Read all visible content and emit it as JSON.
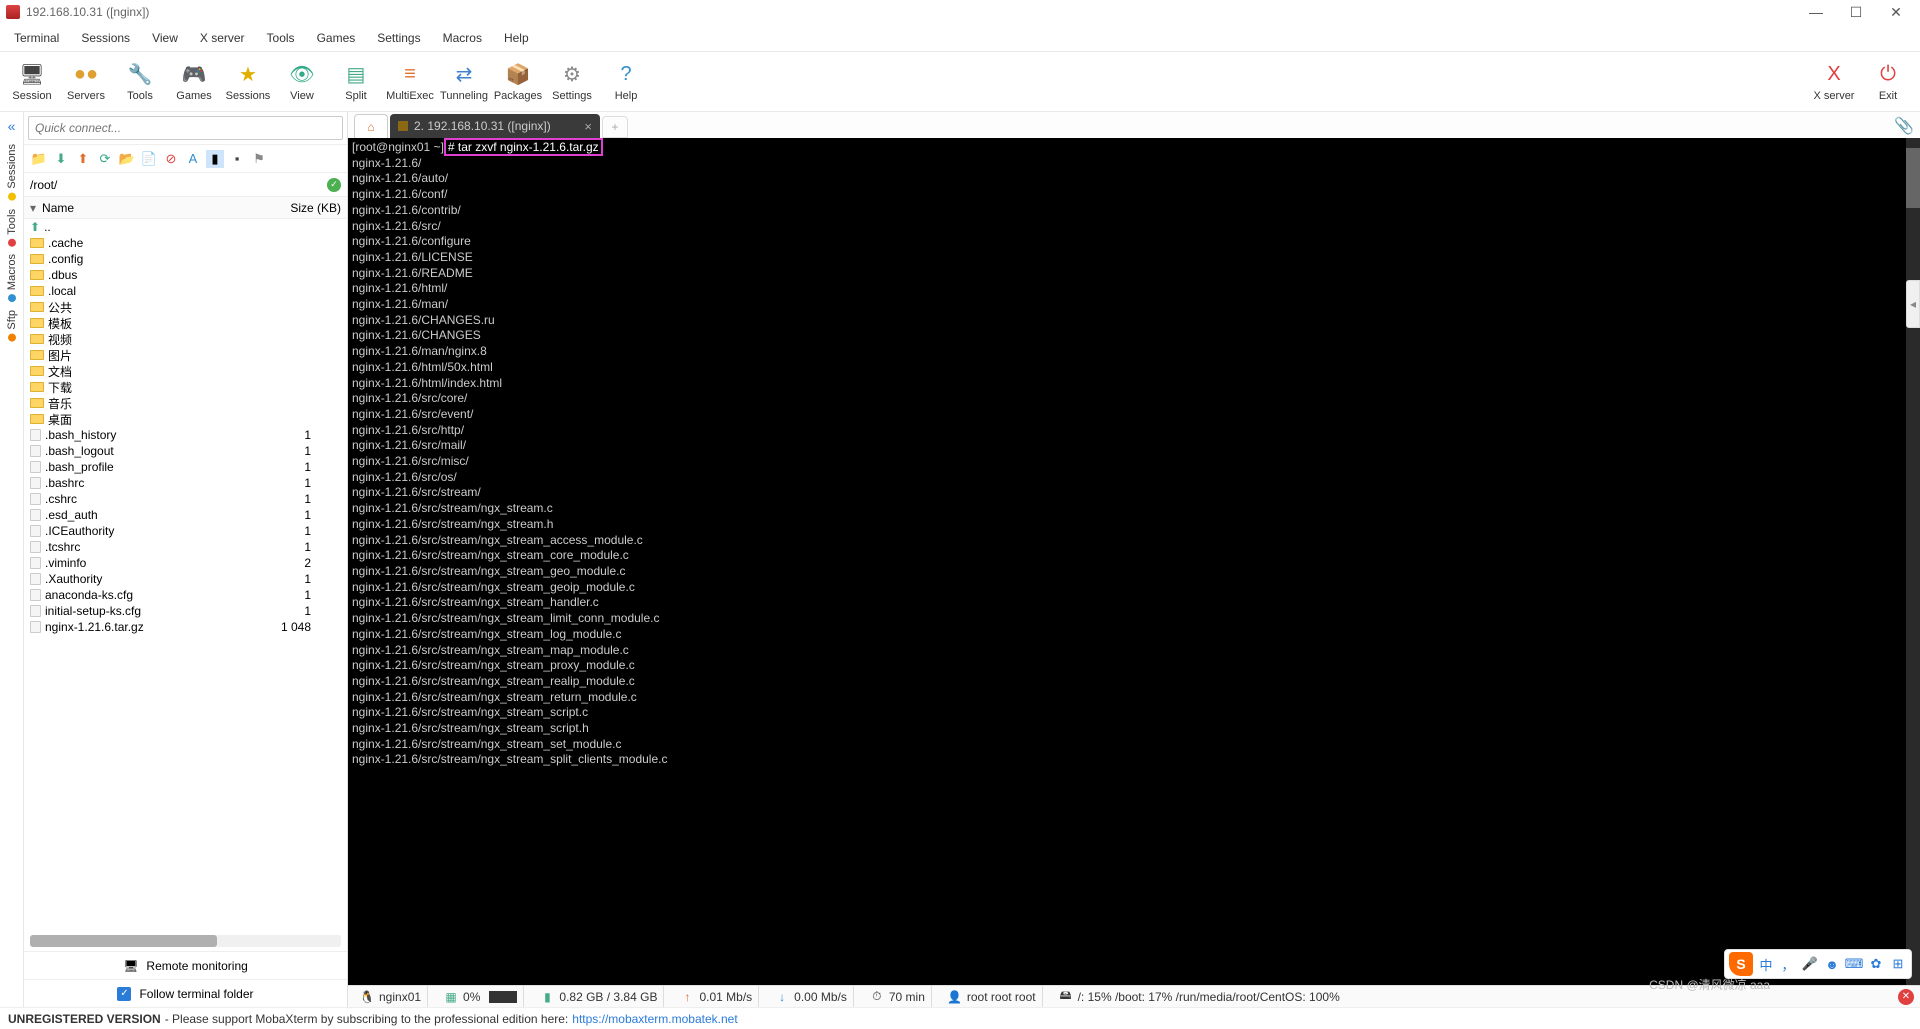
{
  "window": {
    "title": "192.168.10.31 ([nginx])"
  },
  "menu": [
    "Terminal",
    "Sessions",
    "View",
    "X server",
    "Tools",
    "Games",
    "Settings",
    "Macros",
    "Help"
  ],
  "toolbar_left": [
    {
      "label": "Session",
      "icon": "🖥",
      "color": "#444"
    },
    {
      "label": "Servers",
      "icon": "●●",
      "color": "#e0a030"
    },
    {
      "label": "Tools",
      "icon": "🔧",
      "color": "#d04040"
    },
    {
      "label": "Games",
      "icon": "🎮",
      "color": "#9050c0"
    },
    {
      "label": "Sessions",
      "icon": "★",
      "color": "#e0b000"
    },
    {
      "label": "View",
      "icon": "👁",
      "color": "#3a8"
    },
    {
      "label": "Split",
      "icon": "▤",
      "color": "#4a8"
    },
    {
      "label": "MultiExec",
      "icon": "≡",
      "color": "#e07030"
    },
    {
      "label": "Tunneling",
      "icon": "⇄",
      "color": "#4080d0"
    },
    {
      "label": "Packages",
      "icon": "📦",
      "color": "#c0a040"
    },
    {
      "label": "Settings",
      "icon": "⚙",
      "color": "#888"
    },
    {
      "label": "Help",
      "icon": "?",
      "color": "#3090d0"
    }
  ],
  "toolbar_right": [
    {
      "label": "X server",
      "icon": "X",
      "color": "#e04040"
    },
    {
      "label": "Exit",
      "icon": "⏻",
      "color": "#e04040"
    }
  ],
  "quick_placeholder": "Quick connect...",
  "path": "/root/",
  "side_tabs": [
    {
      "label": "Sessions",
      "dot": "#f0c000"
    },
    {
      "label": "Tools",
      "dot": "#e04040"
    },
    {
      "label": "Macros",
      "dot": "#3090d0"
    },
    {
      "label": "Sftp",
      "dot": "#f08000"
    }
  ],
  "file_header": {
    "name": "Name",
    "size": "Size (KB)"
  },
  "files": [
    {
      "name": "..",
      "type": "up",
      "size": ""
    },
    {
      "name": ".cache",
      "type": "dir",
      "size": ""
    },
    {
      "name": ".config",
      "type": "dir",
      "size": ""
    },
    {
      "name": ".dbus",
      "type": "dir",
      "size": ""
    },
    {
      "name": ".local",
      "type": "dir",
      "size": ""
    },
    {
      "name": "公共",
      "type": "dir",
      "size": ""
    },
    {
      "name": "模板",
      "type": "dir",
      "size": ""
    },
    {
      "name": "视频",
      "type": "dir",
      "size": ""
    },
    {
      "name": "图片",
      "type": "dir",
      "size": ""
    },
    {
      "name": "文档",
      "type": "dir",
      "size": ""
    },
    {
      "name": "下载",
      "type": "dir",
      "size": ""
    },
    {
      "name": "音乐",
      "type": "dir",
      "size": ""
    },
    {
      "name": "桌面",
      "type": "dir",
      "size": ""
    },
    {
      "name": ".bash_history",
      "type": "file",
      "size": "1"
    },
    {
      "name": ".bash_logout",
      "type": "file",
      "size": "1"
    },
    {
      "name": ".bash_profile",
      "type": "file",
      "size": "1"
    },
    {
      "name": ".bashrc",
      "type": "file",
      "size": "1"
    },
    {
      "name": ".cshrc",
      "type": "file",
      "size": "1"
    },
    {
      "name": ".esd_auth",
      "type": "file",
      "size": "1"
    },
    {
      "name": ".ICEauthority",
      "type": "file",
      "size": "1"
    },
    {
      "name": ".tcshrc",
      "type": "file",
      "size": "1"
    },
    {
      "name": ".viminfo",
      "type": "file",
      "size": "2"
    },
    {
      "name": ".Xauthority",
      "type": "file",
      "size": "1"
    },
    {
      "name": "anaconda-ks.cfg",
      "type": "file",
      "size": "1"
    },
    {
      "name": "initial-setup-ks.cfg",
      "type": "file",
      "size": "1"
    },
    {
      "name": "nginx-1.21.6.tar.gz",
      "type": "file",
      "size": "1 048"
    }
  ],
  "remote_monitoring": "Remote monitoring",
  "follow_terminal": "Follow terminal folder",
  "tab_term_label": "2. 192.168.10.31 ([nginx])",
  "terminal": {
    "prompt": "[root@nginx01 ~]",
    "command": "# tar zxvf nginx-1.21.6.tar.gz",
    "lines": [
      "nginx-1.21.6/",
      "nginx-1.21.6/auto/",
      "nginx-1.21.6/conf/",
      "nginx-1.21.6/contrib/",
      "nginx-1.21.6/src/",
      "nginx-1.21.6/configure",
      "nginx-1.21.6/LICENSE",
      "nginx-1.21.6/README",
      "nginx-1.21.6/html/",
      "nginx-1.21.6/man/",
      "nginx-1.21.6/CHANGES.ru",
      "nginx-1.21.6/CHANGES",
      "nginx-1.21.6/man/nginx.8",
      "nginx-1.21.6/html/50x.html",
      "nginx-1.21.6/html/index.html",
      "nginx-1.21.6/src/core/",
      "nginx-1.21.6/src/event/",
      "nginx-1.21.6/src/http/",
      "nginx-1.21.6/src/mail/",
      "nginx-1.21.6/src/misc/",
      "nginx-1.21.6/src/os/",
      "nginx-1.21.6/src/stream/",
      "nginx-1.21.6/src/stream/ngx_stream.c",
      "nginx-1.21.6/src/stream/ngx_stream.h",
      "nginx-1.21.6/src/stream/ngx_stream_access_module.c",
      "nginx-1.21.6/src/stream/ngx_stream_core_module.c",
      "nginx-1.21.6/src/stream/ngx_stream_geo_module.c",
      "nginx-1.21.6/src/stream/ngx_stream_geoip_module.c",
      "nginx-1.21.6/src/stream/ngx_stream_handler.c",
      "nginx-1.21.6/src/stream/ngx_stream_limit_conn_module.c",
      "nginx-1.21.6/src/stream/ngx_stream_log_module.c",
      "nginx-1.21.6/src/stream/ngx_stream_map_module.c",
      "nginx-1.21.6/src/stream/ngx_stream_proxy_module.c",
      "nginx-1.21.6/src/stream/ngx_stream_realip_module.c",
      "nginx-1.21.6/src/stream/ngx_stream_return_module.c",
      "nginx-1.21.6/src/stream/ngx_stream_script.c",
      "nginx-1.21.6/src/stream/ngx_stream_script.h",
      "nginx-1.21.6/src/stream/ngx_stream_set_module.c",
      "nginx-1.21.6/src/stream/ngx_stream_split_clients_module.c"
    ]
  },
  "status": {
    "host_icon": "🐧",
    "host": "nginx01",
    "cpu_icon": "▦",
    "cpu": "0%",
    "mem_icon": "▮",
    "mem": "0.82 GB / 3.84 GB",
    "up_icon": "↑",
    "up": "0.01 Mb/s",
    "dn_icon": "↓",
    "dn": "0.00 Mb/s",
    "time_icon": "⏱",
    "time": "70 min",
    "user_icon": "👤",
    "user": "root root root",
    "disk_icon": "🖴",
    "disk": "/: 15%   /boot: 17%   /run/media/root/CentOS: 100%"
  },
  "footer": {
    "unreg": "UNREGISTERED VERSION",
    "text": "  -  Please support MobaXterm by subscribing to the professional edition here:  ",
    "link": "https://mobaxterm.mobatek.net"
  },
  "watermark": "CSDN @清风微凉 aaa",
  "ime": {
    "logo": "S",
    "lang": "中"
  }
}
